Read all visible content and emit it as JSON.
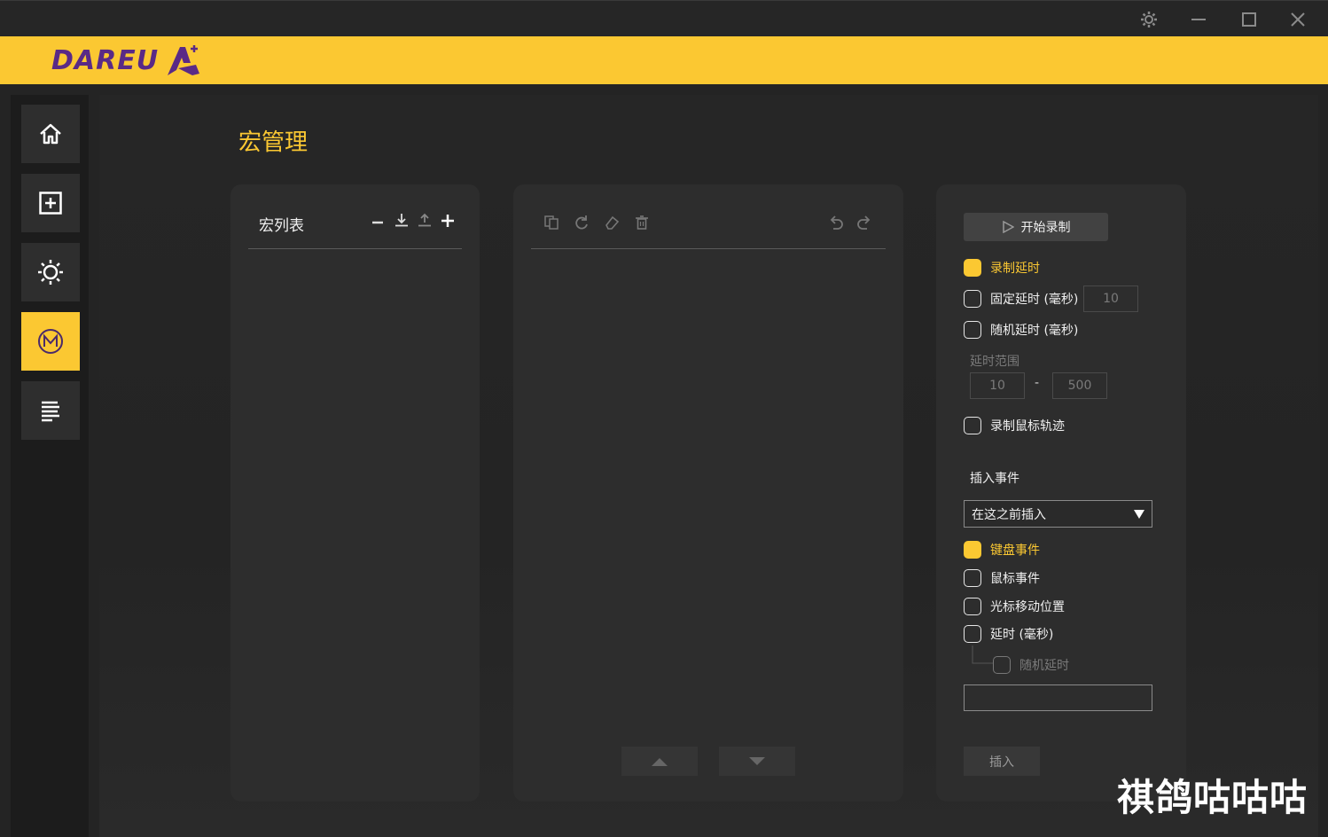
{
  "window": {
    "controls": [
      "gear-icon",
      "minimize-icon",
      "maximize-icon",
      "close-icon"
    ]
  },
  "brand": {
    "logo_text": "DAREU",
    "accent": "#fbc832",
    "logo_color": "#5a2a86"
  },
  "sidebar": {
    "items": [
      {
        "icon": "home-icon",
        "active": false
      },
      {
        "icon": "add-square-icon",
        "active": false
      },
      {
        "icon": "brightness-icon",
        "active": false
      },
      {
        "icon": "macro-m-icon",
        "active": true
      },
      {
        "icon": "text-lines-icon",
        "active": false
      }
    ]
  },
  "page": {
    "title": "宏管理"
  },
  "macro_list": {
    "title": "宏列表",
    "actions": [
      "minus-icon",
      "import-icon",
      "export-icon",
      "plus-icon"
    ]
  },
  "editor": {
    "tools": [
      "copy-icon",
      "redo-circle-icon",
      "eraser-icon",
      "trash-icon"
    ],
    "history": [
      "undo-icon",
      "redo-icon"
    ]
  },
  "record": {
    "start_label": "开始录制",
    "record_delay": "录制延时",
    "fixed_delay": "固定延时 (毫秒)",
    "fixed_delay_value": "10",
    "random_delay": "随机延时 (毫秒)",
    "delay_range_label": "延时范围",
    "range_min": "10",
    "range_sep": "-",
    "range_max": "500",
    "record_mouse_track": "录制鼠标轨迹"
  },
  "insert": {
    "section_label": "插入事件",
    "position_select": "在这之前插入",
    "keyboard_event": "键盘事件",
    "mouse_event": "鼠标事件",
    "cursor_move": "光标移动位置",
    "delay_ms": "延时 (毫秒)",
    "random_delay": "随机延时",
    "insert_label": "插入"
  },
  "watermark": "祺鸽咕咕咕"
}
